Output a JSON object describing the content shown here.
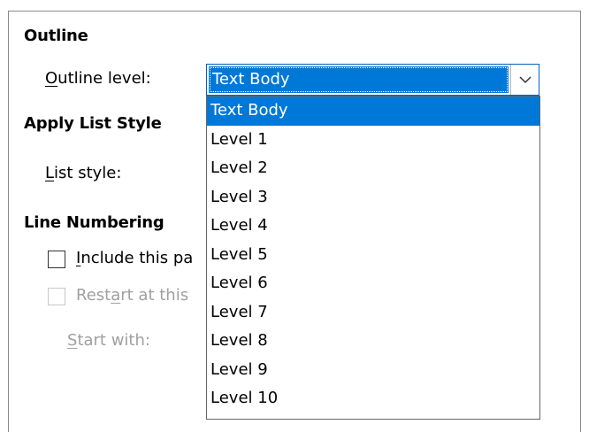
{
  "outline": {
    "heading": "Outline",
    "level_label_prefix": "O",
    "level_label_rest": "utline level:",
    "selected_value": "Text Body",
    "options": [
      "Text Body",
      "Level 1",
      "Level 2",
      "Level 3",
      "Level 4",
      "Level 5",
      "Level 6",
      "Level 7",
      "Level 8",
      "Level 9",
      "Level 10"
    ],
    "selected_index": 0
  },
  "list_style": {
    "heading": "Apply List Style",
    "label_prefix": "L",
    "label_rest": "ist style:"
  },
  "line_numbering": {
    "heading": "Line Numbering",
    "include_prefix": "I",
    "include_rest": "nclude this pa",
    "include_checked": false,
    "restart_pre": "Rest",
    "restart_u": "a",
    "restart_rest": "rt at this",
    "restart_checked": false,
    "start_prefix": "S",
    "start_rest": "tart with:"
  },
  "colors": {
    "highlight": "#0078d7",
    "disabled_text": "#a0a0a0"
  }
}
